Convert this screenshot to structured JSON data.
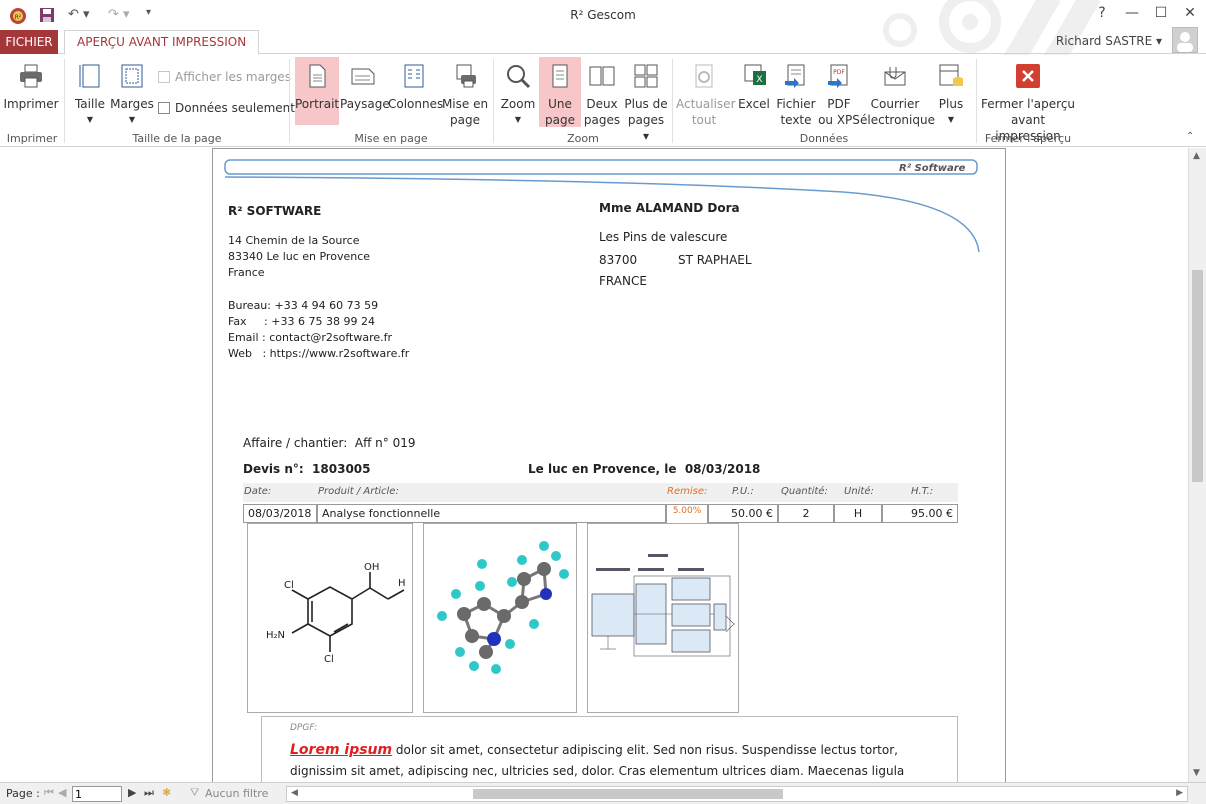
{
  "window": {
    "title": "R² Gescom",
    "help": "?",
    "min": "—",
    "max": "☐",
    "close": "✕"
  },
  "tabs": {
    "file": "FICHIER",
    "preview": "APERÇU AVANT IMPRESSION"
  },
  "user": {
    "name": "Richard SASTRE ▾"
  },
  "ribbon": {
    "print": {
      "label": "Imprimer",
      "group": "Imprimer"
    },
    "size": {
      "label": "Taille",
      "margins": "Marges",
      "show_margins": "Afficher les marges",
      "data_only": "Données seulement",
      "group": "Taille de la page"
    },
    "layout": {
      "portrait": "Portrait",
      "landscape": "Paysage",
      "columns": "Colonnes",
      "page_setup_1": "Mise en",
      "page_setup_2": "page",
      "group": "Mise en page"
    },
    "zoom": {
      "zoom": "Zoom",
      "one_page_1": "Une",
      "one_page_2": "page",
      "two_pages_1": "Deux",
      "two_pages_2": "pages",
      "more_pages_1": "Plus de",
      "more_pages_2": "pages ▾",
      "group": "Zoom"
    },
    "data": {
      "refresh_1": "Actualiser",
      "refresh_2": "tout",
      "excel": "Excel",
      "text_1": "Fichier",
      "text_2": "texte",
      "pdf_1": "PDF",
      "pdf_2": "ou XPS",
      "email_1": "Courrier",
      "email_2": "électronique",
      "more": "Plus",
      "group": "Données"
    },
    "close": {
      "label_1": "Fermer l'aperçu",
      "label_2": "avant impression",
      "group": "Fermer l'aperçu"
    }
  },
  "doc": {
    "header_brand": "R² Software",
    "company": {
      "name": "R² SOFTWARE",
      "address1": "14 Chemin de la Source",
      "address2": "83340 Le luc en Provence",
      "country": "France",
      "phone": "Bureau: +33 4 94 60 73 59",
      "fax": "Fax     : +33 6 75 38 99 24",
      "email": "Email : contact@r2software.fr",
      "web": "Web   : https://www.r2software.fr"
    },
    "client": {
      "name": "Mme ALAMAND Dora",
      "address": "Les Pins de valescure",
      "zip": "83700",
      "city": "ST RAPHAEL",
      "country": "FRANCE"
    },
    "affaire": "Affaire / chantier:  Aff n° 019",
    "devis": "Devis n°:  1803005",
    "place_date": "Le luc en Provence, le  08/03/2018",
    "table": {
      "headers": {
        "date": "Date:",
        "product": "Produit / Article:",
        "discount": "Remise:",
        "pu": "P.U.:",
        "qty": "Quantité:",
        "unit": "Unité:",
        "ht": "H.T.:"
      },
      "row": {
        "date": "08/03/2018",
        "product": "Analyse fonctionnelle",
        "discount": "5.00%",
        "pu": "50.00 €",
        "qty": "2",
        "unit": "H",
        "ht": "95.00 €"
      }
    },
    "dpgf_label": "DPGF:",
    "lorem_head": "Lorem ipsum",
    "lorem_1": " dolor sit amet, consectetur adipiscing elit. Sed non risus. Suspendisse lectus tortor,",
    "lorem_2": "dignissim sit amet, adipiscing nec, ultricies sed, dolor. Cras elementum ultrices diam. Maecenas ligula"
  },
  "status": {
    "page_label": "Page :",
    "page_value": "1",
    "filter": "Aucun filtre"
  },
  "colors": {
    "accent": "#a4373a",
    "active": "#f6c6c8"
  }
}
